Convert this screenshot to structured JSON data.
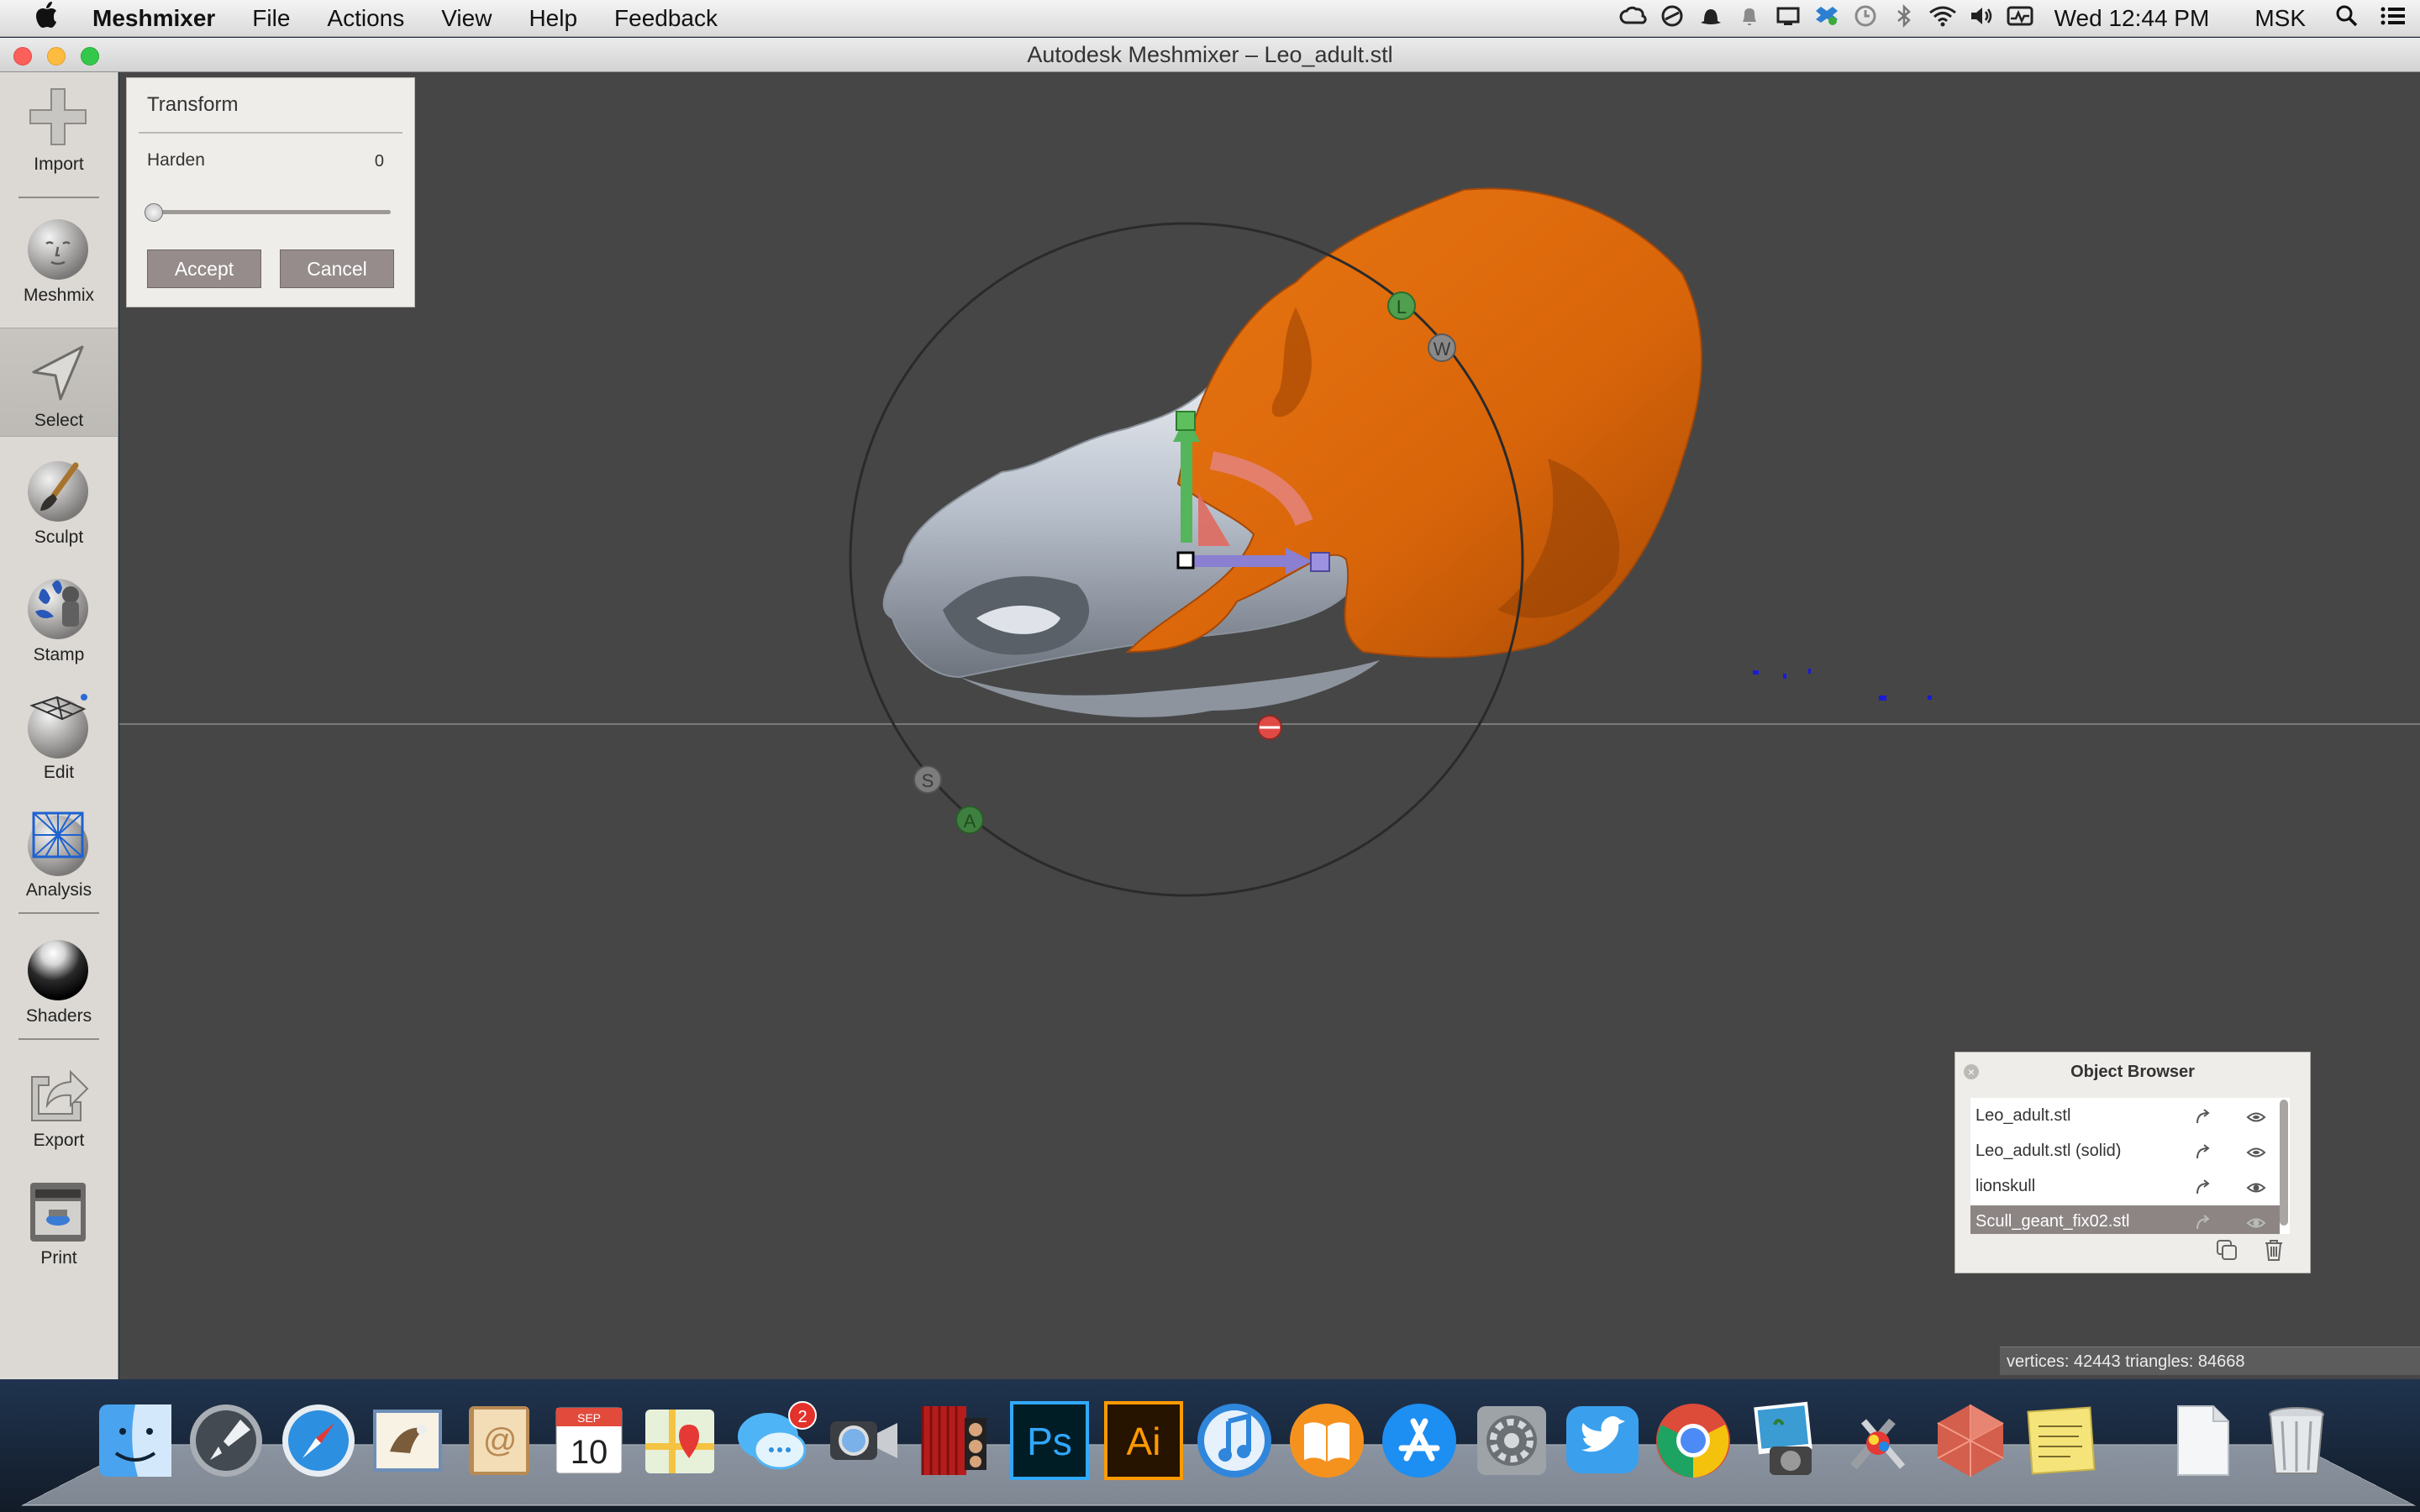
{
  "menubar": {
    "app_name": "Meshmixer",
    "menus": [
      "File",
      "Actions",
      "View",
      "Help",
      "Feedback"
    ],
    "clock": "Wed 12:44 PM",
    "user": "MSK"
  },
  "window": {
    "title": "Autodesk Meshmixer – Leo_adult.stl"
  },
  "toolbar": {
    "tools": [
      {
        "label": "Import",
        "icon": "plus-icon"
      },
      {
        "label": "Meshmix",
        "icon": "face-sphere-icon"
      },
      {
        "label": "Select",
        "icon": "arrow-cursor-icon",
        "active": true
      },
      {
        "label": "Sculpt",
        "icon": "brush-icon"
      },
      {
        "label": "Stamp",
        "icon": "stamp-icon"
      },
      {
        "label": "Edit",
        "icon": "mesh-edit-icon"
      },
      {
        "label": "Analysis",
        "icon": "analysis-mesh-icon"
      },
      {
        "label": "Shaders",
        "icon": "shader-sphere-icon"
      },
      {
        "label": "Export",
        "icon": "export-icon"
      },
      {
        "label": "Print",
        "icon": "printer-icon"
      }
    ]
  },
  "transform": {
    "title": "Transform",
    "harden_label": "Harden",
    "harden_value": "0",
    "harden_fraction": 0,
    "accept_label": "Accept",
    "cancel_label": "Cancel"
  },
  "gizmo": {
    "labels": {
      "local": "L",
      "world": "W",
      "scale": "S",
      "align": "A"
    }
  },
  "object_browser": {
    "title": "Object Browser",
    "close": "×",
    "items": [
      {
        "name": "Leo_adult.stl",
        "selected": false
      },
      {
        "name": "Leo_adult.stl (solid)",
        "selected": false
      },
      {
        "name": "lionskull",
        "selected": false
      },
      {
        "name": "Scull_geant_fix02.stl",
        "selected": true
      }
    ]
  },
  "status": {
    "text": "vertices: 42443  triangles: 84668"
  },
  "colors": {
    "viewport": "#464646",
    "skull_orange": "#d9650a",
    "skull_silver": "#c9d0da",
    "gizmo_green": "#4caf50",
    "gizmo_red": "#e0574f",
    "gizmo_blue": "#7e74c4"
  },
  "dock": {
    "badge_count": "2",
    "icons": [
      "finder-icon",
      "launchpad-icon",
      "safari-icon",
      "mail-icon",
      "contacts-icon",
      "calendar-icon",
      "maps-icon",
      "messages-icon",
      "facetime-icon",
      "photobooth-icon",
      "photoshop-icon",
      "illustrator-icon",
      "itunes-icon",
      "ibooks-icon",
      "appstore-icon",
      "system-preferences-icon",
      "twitter-icon",
      "chrome-icon",
      "iphoto-icon",
      "utilities-icon",
      "meshmixer-icon",
      "stickies-icon",
      "document-icon",
      "trash-icon"
    ],
    "calendar_month": "SEP",
    "calendar_day": "10",
    "photoshop_text": "Ps",
    "illustrator_text": "Ai"
  }
}
